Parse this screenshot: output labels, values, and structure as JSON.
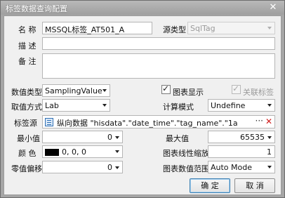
{
  "window": {
    "title": "标签数据查询配置",
    "close_glyph": "✕"
  },
  "form": {
    "name": {
      "label": "名  称",
      "value": "MSSQL标签_AT501_A"
    },
    "source_type": {
      "label": "源类型",
      "value": "SqlTag"
    },
    "description": {
      "label": "描  述",
      "value": ""
    },
    "remark": {
      "label": "备  注",
      "value": ""
    },
    "value_type": {
      "label": "数值类型",
      "value": "SamplingValue"
    },
    "chart_display": {
      "label": "图表显示",
      "checked": true
    },
    "link_tag": {
      "label": "关联标签",
      "checked": true,
      "disabled": true
    },
    "sampling_method": {
      "label": "取值方式",
      "value": "Lab"
    },
    "calc_mode": {
      "label": "计算模式",
      "value": "Undefine"
    },
    "tag_source": {
      "label": "标签源",
      "value": "纵向数据 \"hisdata\".\"date_time\".\"tag_name\".\"1a",
      "more": "···",
      "delete": "✕"
    },
    "min_value": {
      "label": "最小值",
      "value": "0"
    },
    "max_value": {
      "label": "最大值",
      "value": "65535"
    },
    "color": {
      "label": "颜  色",
      "value": "0, 0, 0",
      "swatch": "#000000"
    },
    "chart_scale": {
      "label": "图表线性缩放",
      "value": "1"
    },
    "zero_offset": {
      "label": "零值偏移",
      "value": "0"
    },
    "chart_range": {
      "label": "图表数值范围",
      "value": "Auto Mode"
    }
  },
  "buttons": {
    "ok": "确  定",
    "cancel": "取  消"
  },
  "colors": {
    "titlebar": "#a8a8a8",
    "client": "#f0f0f0",
    "accent": "#3c7fb1",
    "delete": "#d01c1c"
  }
}
